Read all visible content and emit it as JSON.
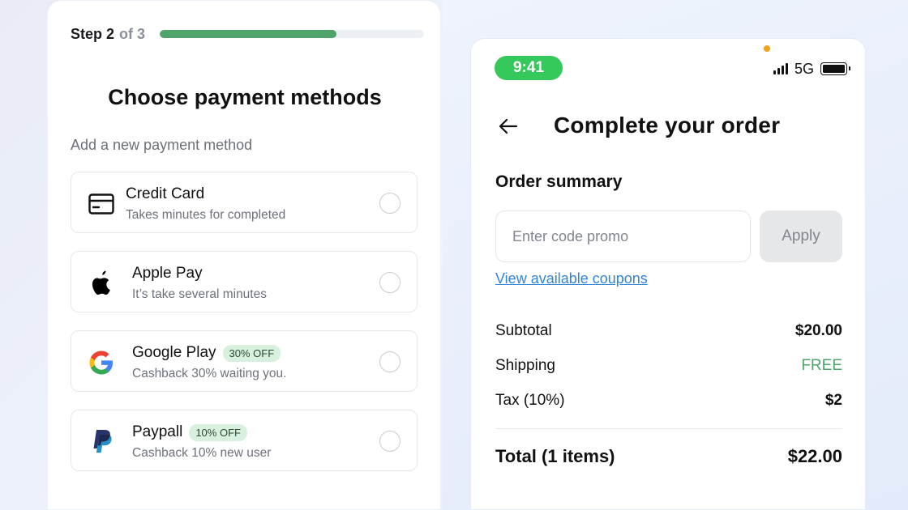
{
  "stepper": {
    "step_label": "Step 2",
    "of_label": "of 3",
    "progress_fraction": 0.67
  },
  "payment_panel": {
    "title": "Choose payment methods",
    "section_label": "Add a new payment method",
    "methods": [
      {
        "name": "Credit Card",
        "subtitle": "Takes minutes for completed",
        "badge": "",
        "icon": "credit-card-icon"
      },
      {
        "name": "Apple Pay",
        "subtitle": "It’s take several minutes",
        "badge": "",
        "icon": "apple-icon"
      },
      {
        "name": "Google Play",
        "subtitle": "Cashback 30% waiting you.",
        "badge": "30% OFF",
        "icon": "google-icon"
      },
      {
        "name": "Paypall",
        "subtitle": "Cashback 10% new user",
        "badge": "10% OFF",
        "icon": "paypal-icon"
      }
    ]
  },
  "phone": {
    "status_bar": {
      "time": "9:41",
      "network": "5G"
    },
    "title": "Complete your order",
    "order_summary_label": "Order summary",
    "promo": {
      "placeholder": "Enter code promo",
      "apply_label": "Apply"
    },
    "coupons_link": "View available coupons",
    "rows": [
      {
        "label": "Subtotal",
        "value": "$20.00"
      },
      {
        "label": "Shipping",
        "value": "FREE"
      },
      {
        "label": "Tax (10%)",
        "value": "$2"
      }
    ],
    "total": {
      "label": "Total (1 items)",
      "value": "$22.00"
    }
  },
  "colors": {
    "accent_green": "#4fa46c",
    "status_green": "#35c85a",
    "link_blue": "#2f84d8",
    "badge_bg": "#d8f0de"
  }
}
